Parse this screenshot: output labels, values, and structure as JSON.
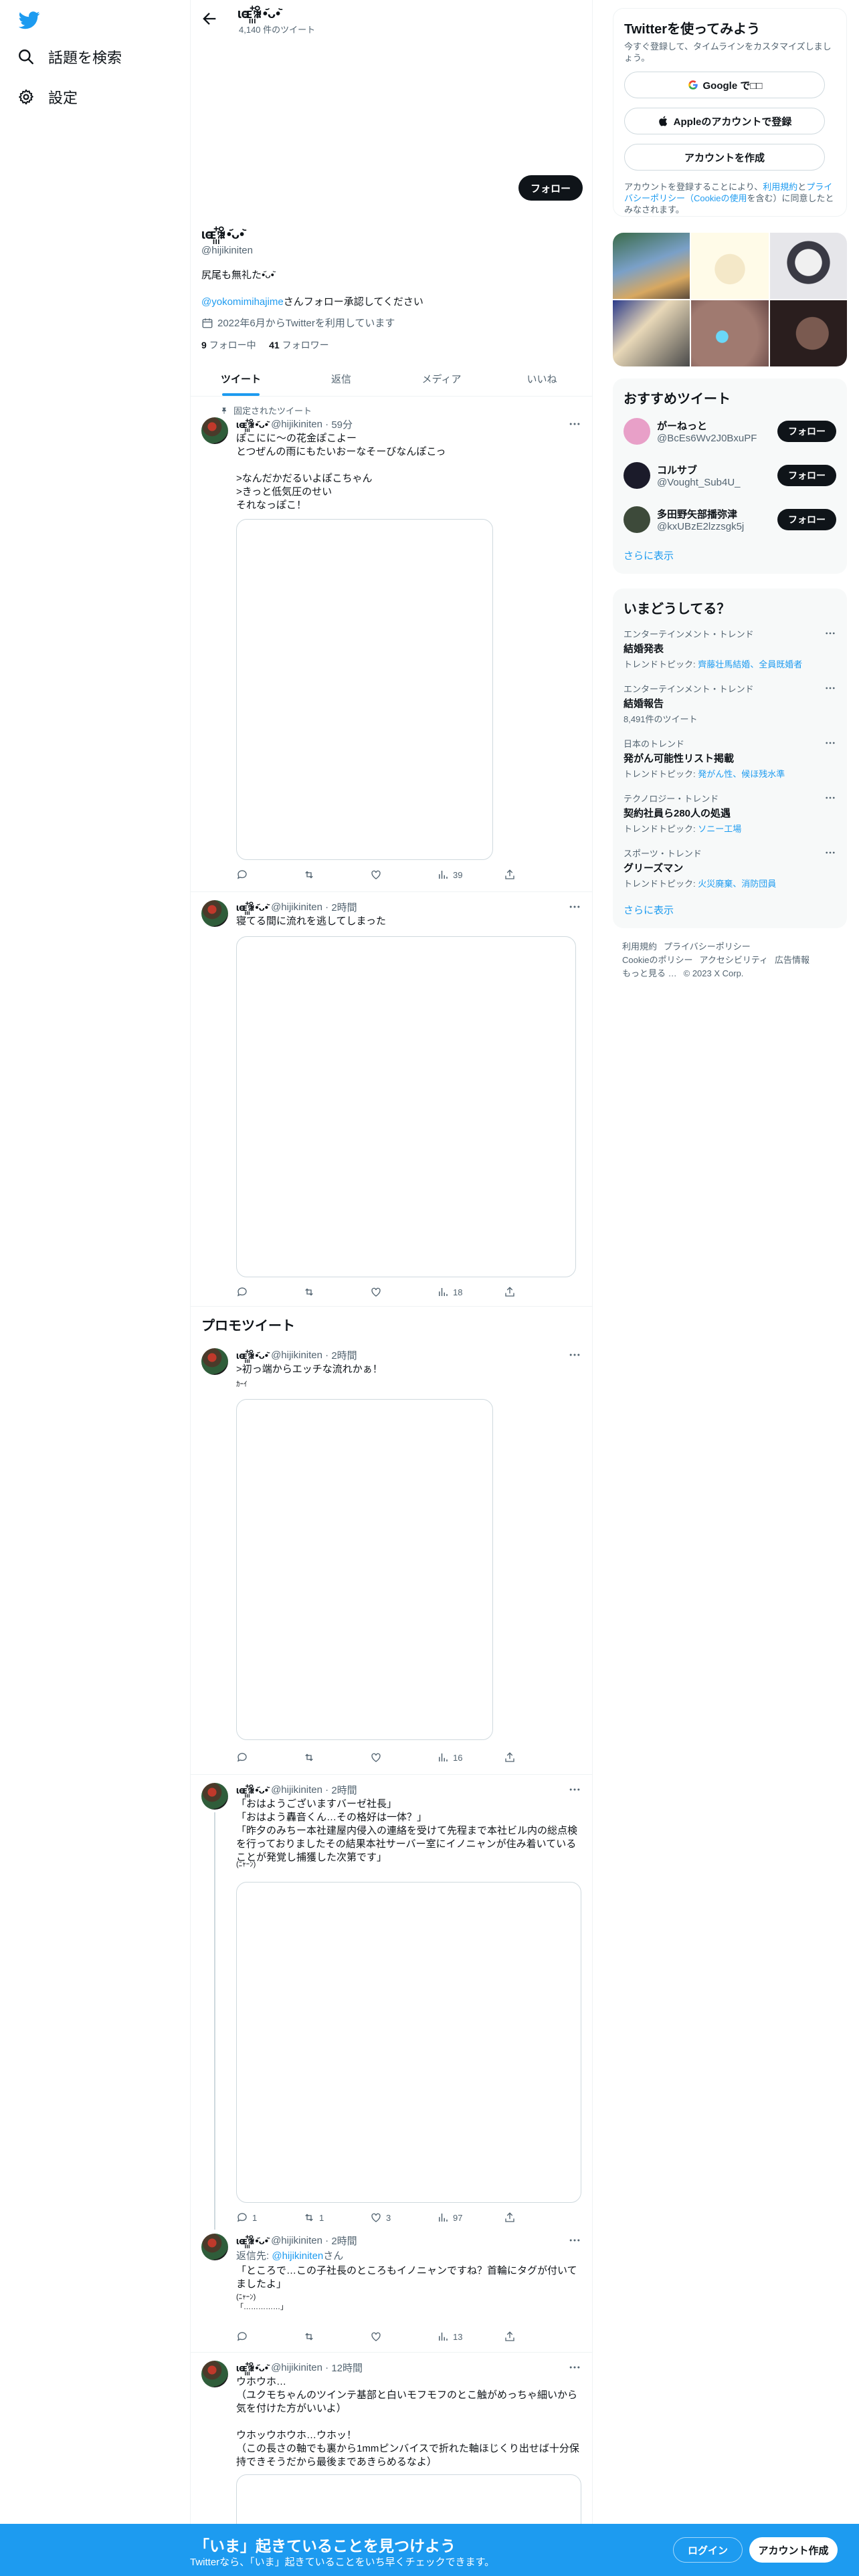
{
  "nav": {
    "search_label": "話題を検索",
    "settings_label": "設定"
  },
  "profile": {
    "display_name": "ɩɶ꙲ꆜ•᷄ᴗ•᷅",
    "tweet_count": "4,140 件のツイート",
    "handle": "@hijikiniten",
    "follow_label": "フォロー",
    "bio": "尻尾も無礼た•᷄ᴗ•᷅",
    "note_link": "@yokomimihajime",
    "note_suffix": "さんフォロー承認してください",
    "joined": "2022年6月からTwitterを利用しています",
    "following_count": "9",
    "following_label": "フォロー中",
    "followers_count": "41",
    "followers_label": "フォロワー"
  },
  "tabs": [
    "ツイート",
    "返信",
    "メディア",
    "いいね"
  ],
  "pinned_label": "固定されたツイート",
  "promoted_label": "プロモツイート",
  "tweets": [
    {
      "name": "ɩɶ꙲ꆜ•᷄ᴗ•᷅",
      "handle": "@hijikiniten",
      "time": "59分",
      "text": "ぽこにに〜の花金ぽこよー\nとつぜんの雨にもたいおーなそーびなんぽこっ\n\n>なんだかだるいよぽこちゃん\n>きっと低気圧のせい\nそれなっぽこ！",
      "reply": "",
      "retweet": "",
      "like": "",
      "views": "39"
    },
    {
      "name": "ɩɶ꙲ꆜ•᷄ᴗ•᷅",
      "handle": "@hijikiniten",
      "time": "2時間",
      "text": "寝てる間に流れを逃してしまった",
      "reply": "",
      "retweet": "",
      "like": "",
      "views": "18"
    },
    {
      "name": "ɩɶ꙲ꆜ•᷄ᴗ•᷅",
      "handle": "@hijikiniten",
      "time": "2時間",
      "text": ">初っ端からエッチな流れかぁ！",
      "small": "ｶｰｲ",
      "reply": "",
      "retweet": "",
      "like": "",
      "views": "16"
    },
    {
      "name": "ɩɶ꙲ꆜ•᷄ᴗ•᷅",
      "handle": "@hijikiniten",
      "time": "2時間",
      "text": "「おはようございますバーゼ社長」\n「おはよう轟音くん…その格好は一体？」\n「昨夕のみちー本社建屋内侵入の連絡を受けて先程まで本社ビル内の総点検を行っておりましたその結果本社サーバー室にイノニャンが住み着いていることが発覚し捕獲した次第です」",
      "small": "(ﾆｬｰﾝ)",
      "reply": "1",
      "retweet": "1",
      "like": "3",
      "views": "97"
    },
    {
      "name": "ɩɶ꙲ꆜ•᷄ᴗ•᷅",
      "handle": "@hijikiniten",
      "time": "2時間",
      "reply_prefix": "返信先: ",
      "reply_link": "@hijikiniten",
      "reply_suffix": "さん",
      "text": "「ところで…この子社長のところもイノニャンですね？首輪にタグが付いてましたよ」",
      "small": "(ﾆｬｰﾝ)\n「……………」",
      "reply": "",
      "retweet": "",
      "like": "",
      "views": "13"
    },
    {
      "name": "ɩɶ꙲ꆜ•᷄ᴗ•᷅",
      "handle": "@hijikiniten",
      "time": "12時間",
      "text": "ウホウホ…\n（ユクモちゃんのツインテ基部と白いモフモフのとこ触がめっちゃ細いから気を付けた方がいいよ）\n\nウホッウホウホ…ウホッ！\n（この長さの軸でも裏から1mmピンバイスで折れた軸ほじくり出せば十分保持できそうだから最後まであきらめるなよ）"
    }
  ],
  "signup": {
    "title": "Twitterを使ってみよう",
    "desc": "今すぐ登録して、タイムラインをカスタマイズしましょう。",
    "google": "Google で□□",
    "apple": "Appleのアカウントで登録",
    "create": "アカウントを作成",
    "terms_prefix": "アカウントを登録することにより、",
    "terms_link1": "利用規約",
    "terms_and": "と",
    "terms_link2": "プライバシーポリシー",
    "terms_link3": "（Cookieの使用",
    "terms_suffix": "を含む）に同意したとみなされます。"
  },
  "recommended": {
    "title": "おすすめツイート",
    "users": [
      {
        "name": "がーねっと",
        "handle": "@BcEs6Wv2J0BxuPF",
        "follow": "フォロー",
        "color": "#e8a0c8"
      },
      {
        "name": "コルサブ",
        "handle": "@Vought_Sub4U_",
        "follow": "フォロー",
        "color": "#1b1b2a"
      },
      {
        "name": "多田野矢部播弥津",
        "handle": "@kxUBzE2lzzsgk5j",
        "follow": "フォロー",
        "color": "#3d4a3a"
      }
    ],
    "more": "さらに表示"
  },
  "trends": {
    "title": "いまどうしてる？",
    "items": [
      {
        "cat": "エンターテインメント・トレンド",
        "name": "結婚発表",
        "sub_prefix": "トレンドトピック: ",
        "sub_link": "齊藤壮馬結婚、全員既婚者",
        "count": ""
      },
      {
        "cat": "エンターテインメント・トレンド",
        "name": "結婚報告",
        "sub_prefix": "",
        "sub_link": "",
        "count": "8,491件のツイート"
      },
      {
        "cat": "日本のトレンド",
        "name": "発がん可能性リスト掲載",
        "sub_prefix": "トレンドトピック: ",
        "sub_link": "発がん性、候ほ残水準",
        "count": ""
      },
      {
        "cat": "テクノロジー・トレンド",
        "name": "契約社員ら280人の処遇",
        "sub_prefix": "トレンドトピック: ",
        "sub_link": "ソニー工場",
        "count": ""
      },
      {
        "cat": "スポーツ・トレンド",
        "name": "グリーズマン",
        "sub_prefix": "トレンドトピック: ",
        "sub_link": "火災廃棄、消防団員",
        "count": ""
      }
    ],
    "more": "さらに表示"
  },
  "footer": {
    "line1": [
      "利用規約",
      "プライバシーポリシー"
    ],
    "line2": [
      "Cookieのポリシー",
      "アクセシビリティ",
      "広告情報"
    ],
    "line3": [
      "もっと見る …",
      "© 2023 X Corp."
    ]
  },
  "bottom": {
    "title": "「いま」起きていることを見つけよう",
    "sub": "Twitterなら、「いま」起きていることをいち早くチェックできます。",
    "login": "ログイン",
    "signup": "アカウント作成"
  },
  "colors": {
    "accent": "#1d9bf0",
    "text": "#0f1419",
    "muted": "#536471",
    "border": "#eff3f4"
  },
  "icons": [
    "twitter-bird-icon",
    "hashtag-search-icon",
    "gear-icon",
    "back-arrow-icon",
    "calendar-icon",
    "pin-icon",
    "more-icon",
    "reply-icon",
    "retweet-icon",
    "like-icon",
    "views-icon",
    "share-icon",
    "google-icon",
    "apple-icon"
  ]
}
